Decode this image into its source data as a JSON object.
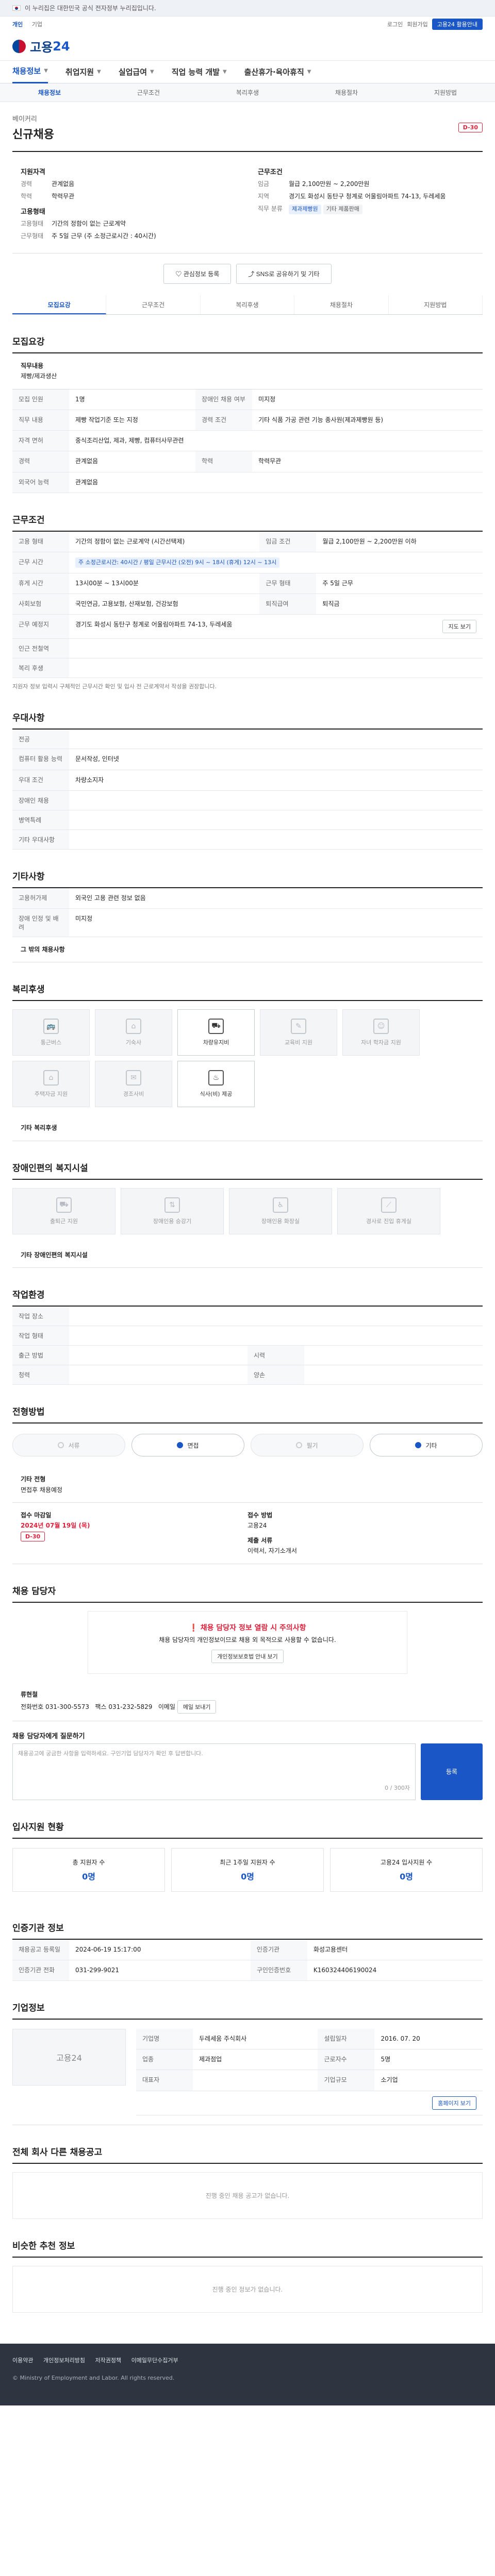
{
  "banner": "이 누리집은 대한민국 공식 전자정부 누리집입니다.",
  "top_links": [
    "개인",
    "기업"
  ],
  "top_right": [
    "로그인",
    "회원가입",
    "고용24 활용안내"
  ],
  "logo": {
    "text": "고용",
    "num": "24"
  },
  "gnb": [
    "채용정보",
    "취업지원",
    "실업급여",
    "직업 능력 개발",
    "출산휴가·육아휴직"
  ],
  "subnav": [
    "채용정보",
    "근무조건",
    "복리후생",
    "채용절차",
    "지원방법"
  ],
  "job": {
    "company": "베이커리",
    "title": "신규채용",
    "dday": "D-30"
  },
  "summary": {
    "left_title": "지원자격",
    "left_items": [
      {
        "k": "경력",
        "v": "관계없음"
      },
      {
        "k": "학력",
        "v": "학력무관"
      }
    ],
    "left2_title": "고용형태",
    "left2_items": [
      {
        "k": "고용형태",
        "v": "기간의 정함이 없는 근로계약"
      },
      {
        "k": "근무형태",
        "v": "주 5일 근무 (주 소정근로시간 : 40시간)"
      }
    ],
    "right_title": "근무조건",
    "right_items": [
      {
        "k": "임금",
        "v": "월급 2,100만원 ~ 2,200만원"
      },
      {
        "k": "지역",
        "v": "경기도 화성시 동탄구 청계로 어울림아파트 74-13, 두레세움"
      },
      {
        "k": "직무 분류",
        "v": "제과제빵원"
      }
    ],
    "right_tags": [
      "제과제빵원",
      "기타 제품판매"
    ]
  },
  "actions": {
    "scrap": "관심정보 등록",
    "share": "SNS로 공유하기 및 기타"
  },
  "tabs": [
    "모집요강",
    "근무조건",
    "복리후생",
    "채용절차",
    "지원방법"
  ],
  "recruit": {
    "title": "모집요강",
    "duty_label": "직무내용",
    "duty_value": "제빵/제과생산",
    "rows": [
      {
        "k": "모집 인원",
        "v": "1명",
        "k2": "장애인 채용 여부",
        "v2": "미지정"
      },
      {
        "k": "직무 내용",
        "v": "제빵 작업기준 또는 지정",
        "k2": "경력 조건",
        "v2": "기타 식품 가공 관련 기능 종사원(제과제빵원 등)"
      },
      {
        "k": "자격 면허",
        "v": "중식조리산업, 제과, 제빵, 컴퓨터사무관련",
        "k2": "",
        "v2": ""
      },
      {
        "k": "경력",
        "v": "관계없음",
        "k2": "학력",
        "v2": "학력무관"
      },
      {
        "k": "외국어 능력",
        "v": "관계없음",
        "k2": "",
        "v2": ""
      }
    ]
  },
  "conditions": {
    "title": "근무조건",
    "rows": [
      {
        "k": "고용 형태",
        "v": "기간의 정함이 없는 근로계약 (시간선택제)",
        "k2": "임금 조건",
        "v2": "월급 2,100만원 ~ 2,200만원 이하"
      },
      {
        "k": "근무 시간",
        "v": "주 소정근로시간: 40시간 / 평일 근무시간 (오전) 9시 ~ 18시 (휴게) 12시 ~ 13시",
        "k2": "",
        "v2": ""
      },
      {
        "k": "휴게 시간",
        "v": "13시00분 ~ 13시00분",
        "k2": "근무 형태",
        "v2": "주 5일 근무"
      },
      {
        "k": "사회보험",
        "v": "국민연금, 고용보험, 산재보험, 건강보험",
        "k2": "퇴직급여",
        "v2": "퇴직금"
      },
      {
        "k": "근무 예정지",
        "v": "경기도 화성시 동탄구 청계로 어울림아파트 74-13, 두레세움",
        "k2": "",
        "v2": ""
      },
      {
        "k": "인근 전철역",
        "v": "",
        "k2": "",
        "v2": ""
      },
      {
        "k": "복리 후생",
        "v": "",
        "k2": "",
        "v2": ""
      }
    ],
    "note": "지원자 정보 입력시 구체적인 근무시간 확인 및 입사 전 근로계약서 작성을 권장합니다.",
    "map_button": "지도 보기"
  },
  "preferences": {
    "title": "우대사항",
    "rows": [
      {
        "k": "전공",
        "v": ""
      },
      {
        "k": "컴퓨터 활용 능력",
        "v": ""
      },
      {
        "k": "우대 조건",
        "v": ""
      },
      {
        "k": "장애인 채용",
        "v": ""
      },
      {
        "k": "병역특례",
        "v": ""
      },
      {
        "k": "기타 우대사항",
        "v": ""
      }
    ],
    "value_pc": "문서작성, 인터넷",
    "value_pref": "차량소지자"
  },
  "extra": {
    "title": "기타사항",
    "rows": [
      {
        "k": "고용허가제",
        "v": "외국인 고용 관련 정보 없음"
      },
      {
        "k": "장애 인정 및 배려",
        "v": "미지정"
      }
    ],
    "etc_label": "그 밖의 채용사항"
  },
  "benefits": {
    "title": "복리후생",
    "cards": [
      {
        "name": "통근버스",
        "icon": "bus-icon",
        "on": false
      },
      {
        "name": "기숙사",
        "icon": "dorm-icon",
        "on": false
      },
      {
        "name": "차량유지비",
        "icon": "car-icon",
        "on": true
      },
      {
        "name": "교육비 지원",
        "icon": "edu-icon",
        "on": false
      },
      {
        "name": "자녀 학자금 지원",
        "icon": "child-icon",
        "on": false
      },
      {
        "name": "주택자금 지원",
        "icon": "house-icon",
        "on": false
      },
      {
        "name": "경조사비",
        "icon": "gift-icon",
        "on": false
      },
      {
        "name": "식사(비) 제공",
        "icon": "meal-icon",
        "on": true
      }
    ],
    "etc_label": "기타 복리후생"
  },
  "disabled_facilities": {
    "title": "장애인편의 복지시설",
    "cards": [
      "출퇴근 지원",
      "장애인용 승강기",
      "장애인용 화장실",
      "경사로 진입 휴게실"
    ],
    "etc_label": "기타 장애인편의 복지시설"
  },
  "apply_env": {
    "title": "작업환경",
    "rows": [
      {
        "k": "작업 장소",
        "v": "",
        "k2": "",
        "v2": ""
      },
      {
        "k": "작업 형태",
        "v": "",
        "k2": "",
        "v2": ""
      },
      {
        "k": "출근 방법",
        "v": "",
        "k2": "시력",
        "v2": ""
      },
      {
        "k": "청력",
        "v": "",
        "k2": "양손",
        "v2": ""
      }
    ]
  },
  "process": {
    "title": "전형방법",
    "steps": [
      {
        "label": "서류",
        "on": false
      },
      {
        "label": "면접",
        "on": true
      },
      {
        "label": "필기",
        "on": false
      },
      {
        "label": "기타",
        "on": true
      }
    ],
    "etc_label": "기타 전형",
    "etc_value": "면접후 채용예정",
    "deadline_label": "접수 마감일",
    "deadline_value": "2024년 07월 19일 (목)",
    "deadline_dday": "D-30",
    "method_label": "접수 방법",
    "method_value": "고용24",
    "docs_label": "제출 서류",
    "docs_value": "이력서, 자기소개서"
  },
  "contact": {
    "title": "채용 담당자",
    "warn_title": "채용 담당자 정보 열람 시 주의사항",
    "warn_body": "채용 담당자의 개인정보이므로 채용 외 목적으로 사용할 수 없습니다.",
    "warn_button": "개인정보보호법 안내 보기",
    "person": "류현철",
    "phone_label": "전화번호",
    "phone": "031-300-5573",
    "fax_label": "팩스",
    "fax": "031-232-5829",
    "email_label": "이메일",
    "email_button": "메일 보내기",
    "inquiry_title": "채용 담당자에게 질문하기",
    "inquiry_placeholder": "채용공고에 궁금한 사항을 입력하세요. 구인기업 담당자가 확인 후 답변합니다.",
    "inquiry_count": "0 / 300자",
    "inquiry_button": "등록"
  },
  "apply_status": {
    "title": "입사지원 현황",
    "cards": [
      {
        "name": "총 지원자 수",
        "count": "0명"
      },
      {
        "name": "최근 1주일 지원자 수",
        "count": "0명"
      },
      {
        "name": "고용24 입사지원 수",
        "count": "0명"
      }
    ]
  },
  "agency": {
    "title": "인증기관 정보",
    "rows": [
      {
        "k": "채용공고 등록일",
        "v": "2024-06-19 15:17:00",
        "k2": "인증기관",
        "v2": "화성고용센터"
      },
      {
        "k": "인증기관 전화",
        "v": "031-299-9021",
        "k2": "구인인증번호",
        "v2": "K160324406190024"
      }
    ]
  },
  "company": {
    "title": "기업정보",
    "logo_text": "고용24",
    "rows": [
      {
        "k": "기업명",
        "v": "두레세움 주식회사"
      },
      {
        "k": "업종",
        "v": "제과점업"
      },
      {
        "k": "대표자",
        "v": ""
      },
      {
        "k": "설립일자",
        "v": "2016. 07. 20"
      },
      {
        "k": "근로자수",
        "v": "5명"
      },
      {
        "k": "기업규모",
        "v": "소기업"
      }
    ],
    "homepage_button": "홈페이지 보기"
  },
  "similar": {
    "title": "전체 회사 다른 채용공고",
    "empty": "진행 중인 채용 공고가 없습니다."
  },
  "recommend": {
    "title": "비슷한 추천 정보",
    "empty": "진행 중인 정보가 없습니다."
  },
  "footer": {
    "links": [
      "이용약관",
      "개인정보처리방침",
      "저작권정책",
      "이메일무단수집거부"
    ],
    "copy": "© Ministry of Employment and Labor. All rights reserved."
  }
}
